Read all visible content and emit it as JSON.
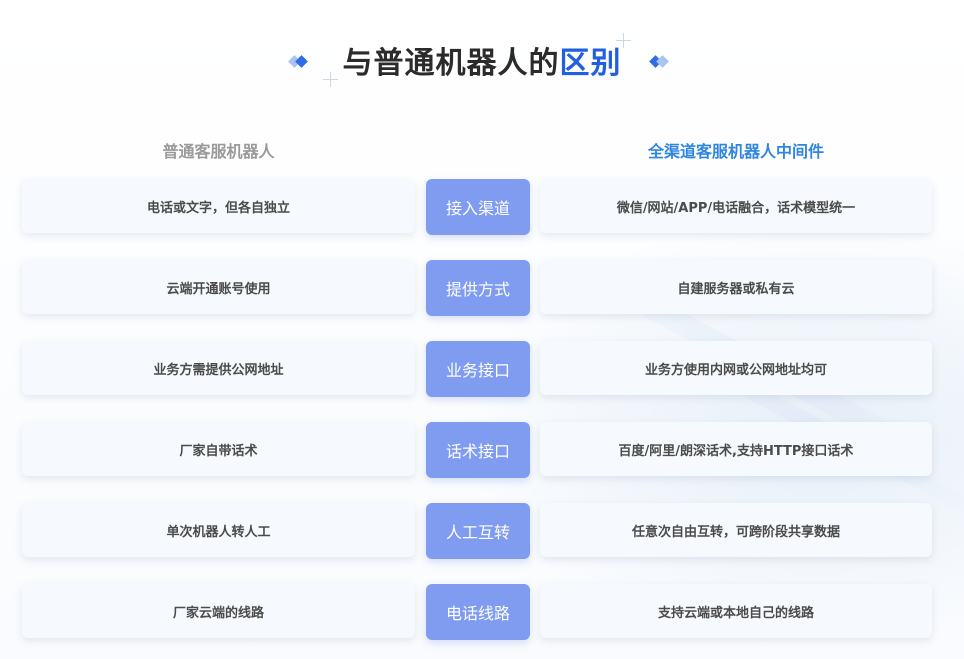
{
  "title": {
    "main": "与普通机器人的",
    "accent": "区别"
  },
  "columns": {
    "left": "普通客服机器人",
    "right": "全渠道客服机器人中间件"
  },
  "rows": [
    {
      "left": "电话或文字，但各自独立",
      "mid": "接入渠道",
      "right": "微信/网站/APP/电话融合，话术模型统一"
    },
    {
      "left": "云端开通账号使用",
      "mid": "提供方式",
      "right": "自建服务器或私有云"
    },
    {
      "left": "业务方需提供公网地址",
      "mid": "业务接口",
      "right": "业务方使用内网或公网地址均可"
    },
    {
      "left": "厂家自带话术",
      "mid": "话术接口",
      "right": "百度/阿里/朗深话术,支持HTTP接口话术"
    },
    {
      "left": "单次机器人转人工",
      "mid": "人工互转",
      "right": "任意次自由互转，可跨阶段共享数据"
    },
    {
      "left": "厂家云端的线路",
      "mid": "电话线路",
      "right": "支持云端或本地自己的线路"
    }
  ],
  "colors": {
    "accent": "#1f5fe0",
    "mid_chip": "#7f9cf0",
    "right_header": "#2f86e0",
    "left_header": "#9a9a9a"
  }
}
